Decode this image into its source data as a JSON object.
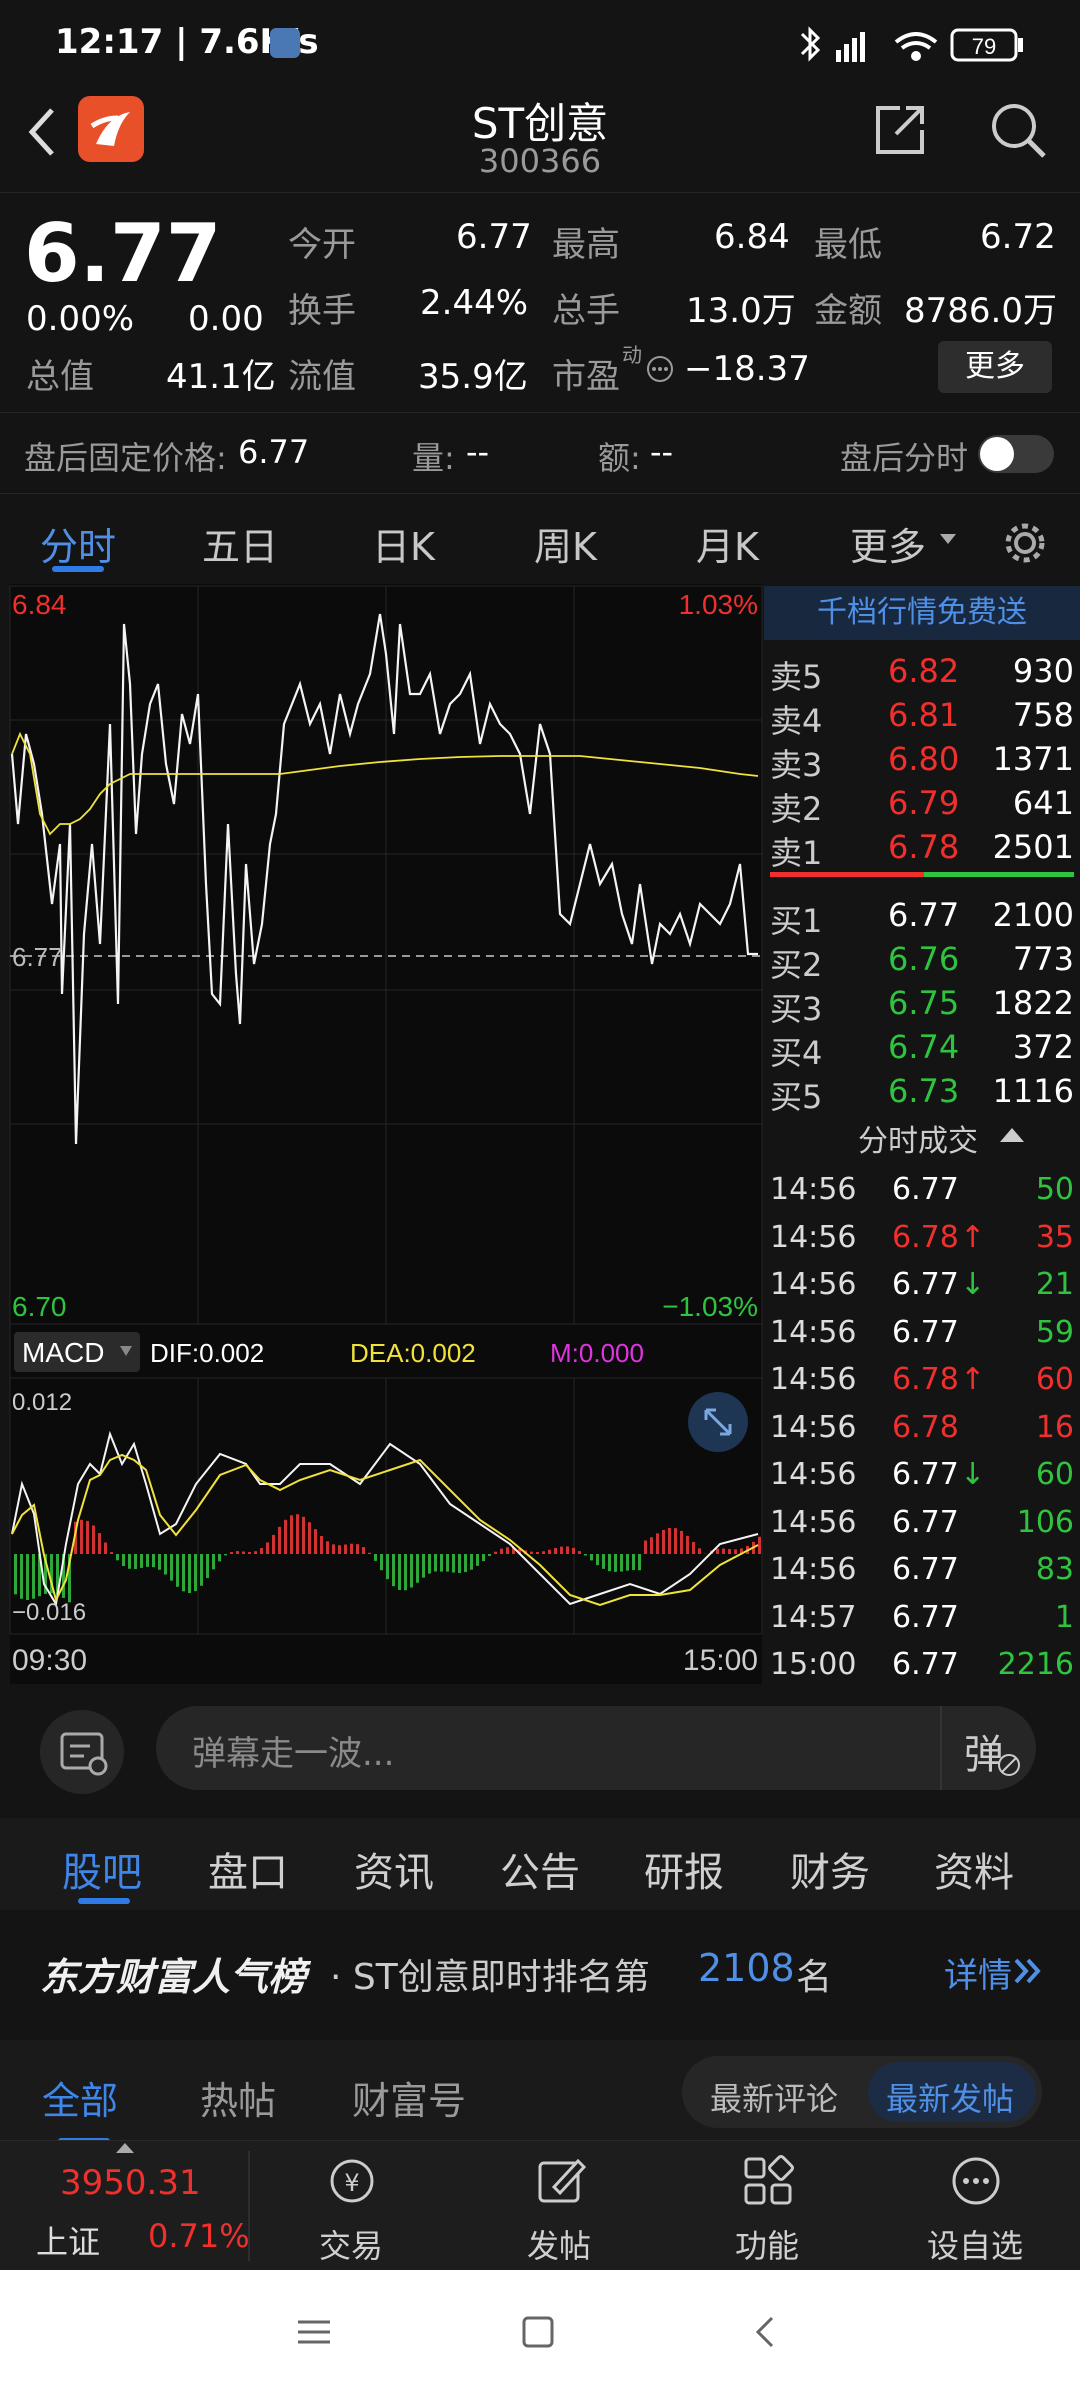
{
  "status": {
    "time": "12:17 | 7.6K/s",
    "battery": "79"
  },
  "header": {
    "title": "ST创意",
    "code": "300366"
  },
  "quote": {
    "price": "6.77",
    "change_pct": "0.00%",
    "change": "0.00",
    "total_mv_label": "总值",
    "total_mv": "41.1亿",
    "open_label": "今开",
    "open": "6.77",
    "high_label": "最高",
    "high": "6.84",
    "low_label": "最低",
    "low": "6.72",
    "turnover_label": "换手",
    "turnover": "2.44%",
    "volume_label": "总手",
    "volume": "13.0万",
    "amount_label": "金额",
    "amount": "8786.0万",
    "float_mv_label": "流值",
    "float_mv": "35.9亿",
    "pe_label": "市盈",
    "pe_sup": "动",
    "pe": "−18.37",
    "more": "更多"
  },
  "afterhours": {
    "fixed_price_label": "盘后固定价格:",
    "fixed_price": "6.77",
    "vol_label": "量:",
    "vol": "--",
    "amt_label": "额:",
    "amt": "--",
    "intraday_label": "盘后分时"
  },
  "chart_tabs": [
    "分时",
    "五日",
    "日K",
    "周K",
    "月K",
    "更多"
  ],
  "chart": {
    "top_price": "6.84",
    "top_pct": "1.03%",
    "bottom_price": "6.70",
    "bottom_pct": "−1.03%",
    "mid_price": "6.77",
    "macd_label": "MACD",
    "dif": "DIF:0.002",
    "dea": "DEA:0.002",
    "m": "M:0.000",
    "macd_top": "0.012",
    "macd_bottom": "−0.016",
    "time_start": "09:30",
    "time_end": "15:00"
  },
  "orderbook": {
    "promo": "千档行情免费送",
    "asks": [
      {
        "label": "卖5",
        "price": "6.82",
        "vol": "930"
      },
      {
        "label": "卖4",
        "price": "6.81",
        "vol": "758"
      },
      {
        "label": "卖3",
        "price": "6.80",
        "vol": "1371"
      },
      {
        "label": "卖2",
        "price": "6.79",
        "vol": "641"
      },
      {
        "label": "卖1",
        "price": "6.78",
        "vol": "2501"
      }
    ],
    "bids": [
      {
        "label": "买1",
        "price": "6.77",
        "vol": "2100"
      },
      {
        "label": "买2",
        "price": "6.76",
        "vol": "773"
      },
      {
        "label": "买3",
        "price": "6.75",
        "vol": "1822"
      },
      {
        "label": "买4",
        "price": "6.74",
        "vol": "372"
      },
      {
        "label": "买5",
        "price": "6.73",
        "vol": "1116"
      }
    ],
    "trades_title": "分时成交",
    "trades": [
      {
        "time": "14:56",
        "price": "6.77",
        "arrow": "",
        "vol": "50"
      },
      {
        "time": "14:56",
        "price": "6.78",
        "arrow": "↑",
        "vol": "35"
      },
      {
        "time": "14:56",
        "price": "6.77",
        "arrow": "↓",
        "vol": "21"
      },
      {
        "time": "14:56",
        "price": "6.77",
        "arrow": "",
        "vol": "59"
      },
      {
        "time": "14:56",
        "price": "6.78",
        "arrow": "↑",
        "vol": "60"
      },
      {
        "time": "14:56",
        "price": "6.78",
        "arrow": "",
        "vol": "16"
      },
      {
        "time": "14:56",
        "price": "6.77",
        "arrow": "↓",
        "vol": "60"
      },
      {
        "time": "14:56",
        "price": "6.77",
        "arrow": "",
        "vol": "106"
      },
      {
        "time": "14:56",
        "price": "6.77",
        "arrow": "",
        "vol": "83"
      },
      {
        "time": "14:57",
        "price": "6.77",
        "arrow": "",
        "vol": "1"
      },
      {
        "time": "15:00",
        "price": "6.77",
        "arrow": "",
        "vol": "2216"
      }
    ]
  },
  "comment": {
    "placeholder": "弹幕走一波...",
    "danmu": "弹"
  },
  "forum_tabs": [
    "股吧",
    "盘口",
    "资讯",
    "公告",
    "研报",
    "财务",
    "资料"
  ],
  "ranking": {
    "brand": "东方财富人气榜",
    "text": "· ST创意即时排名第",
    "rank": "2108",
    "suffix": "名",
    "detail": "详情"
  },
  "subtabs": {
    "items": [
      "全部",
      "热帖",
      "财富号"
    ],
    "sort_a": "最新评论",
    "sort_b": "最新发帖"
  },
  "bottomnav": {
    "index_value": "3950.31",
    "index_name": "上证",
    "index_pct": "0.71%",
    "items": [
      "交易",
      "发帖",
      "功能",
      "设自选"
    ]
  }
}
